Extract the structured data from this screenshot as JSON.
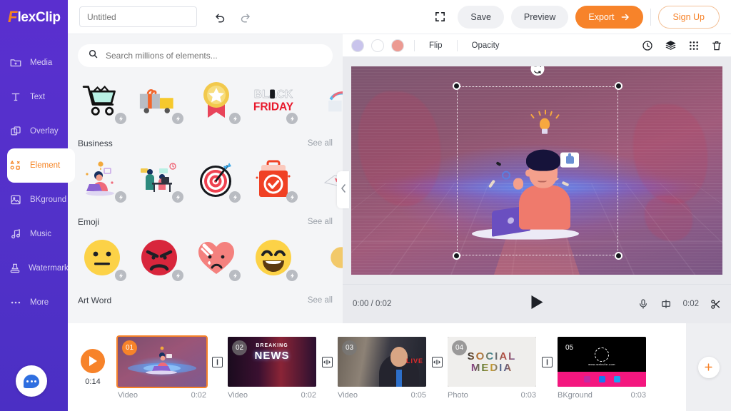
{
  "brand": {
    "accent_letter": "F",
    "rest": "lexClip",
    "accent_color": "#f58220"
  },
  "topbar": {
    "project_title_value": "",
    "project_title_placeholder": "Untitled",
    "undo_icon": "undo-icon",
    "redo_icon": "redo-icon",
    "fullscreen_icon": "fullscreen-icon",
    "save_label": "Save",
    "preview_label": "Preview",
    "export_label": "Export",
    "signup_label": "Sign Up",
    "export_color": "#f7832a"
  },
  "sidebar": {
    "items": [
      {
        "label": "Media",
        "icon": "media-folder-icon",
        "active": false
      },
      {
        "label": "Text",
        "icon": "text-t-icon",
        "active": false
      },
      {
        "label": "Overlay",
        "icon": "overlay-squares-icon",
        "active": false
      },
      {
        "label": "Element",
        "icon": "element-shapes-icon",
        "active": true
      },
      {
        "label": "BKground",
        "icon": "background-image-icon",
        "active": false
      },
      {
        "label": "Music",
        "icon": "music-note-icon",
        "active": false
      },
      {
        "label": "Watermark",
        "icon": "watermark-stamp-icon",
        "active": false
      },
      {
        "label": "More",
        "icon": "more-dots-icon",
        "active": false
      }
    ],
    "chat_icon": "chat-bubble-icon"
  },
  "panel": {
    "search": {
      "value": "",
      "placeholder": "Search millions of elements...",
      "icon": "search-icon"
    },
    "see_all_label": "See all",
    "rows": [
      {
        "category": "",
        "show_header": false,
        "items": [
          {
            "name": "shopping-cart-element"
          },
          {
            "name": "gift-truck-element"
          },
          {
            "name": "award-badge-element"
          },
          {
            "name": "black-friday-element"
          },
          {
            "name": "partial-element"
          }
        ]
      },
      {
        "category": "Business",
        "show_header": true,
        "items": [
          {
            "name": "person-laptop-element"
          },
          {
            "name": "office-meeting-element"
          },
          {
            "name": "target-dartboard-element"
          },
          {
            "name": "checklist-clipboard-element"
          },
          {
            "name": "partial-element"
          }
        ]
      },
      {
        "category": "Emoji",
        "show_header": true,
        "items": [
          {
            "name": "neutral-face-emoji"
          },
          {
            "name": "angry-face-emoji"
          },
          {
            "name": "broken-heart-emoji"
          },
          {
            "name": "grinning-face-emoji"
          },
          {
            "name": "partial-emoji"
          }
        ]
      },
      {
        "category": "Art Word",
        "show_header": true,
        "items": []
      }
    ],
    "collapse_icon": "chevron-left-icon"
  },
  "canvas": {
    "toolbar": {
      "swatches": [
        "#c9c4ec",
        "#ffffff",
        "#ec9a92"
      ],
      "flip_label": "Flip",
      "opacity_label": "Opacity",
      "right_icons": [
        "clock-icon",
        "layers-icon",
        "grid-icon",
        "trash-icon"
      ]
    },
    "selection": {
      "rotate_icon": "rotate-icon",
      "handles": [
        "top-left",
        "top-right",
        "bottom-left",
        "bottom-right"
      ]
    },
    "player": {
      "current_time": "0:00",
      "separator": "/",
      "duration": "0:02",
      "time_display": "0:00 / 0:02",
      "play_icon": "play-icon",
      "mic_icon": "microphone-icon",
      "split_icon": "split-icon",
      "clip_duration": "0:02",
      "scissors_icon": "scissors-icon"
    }
  },
  "timeline": {
    "play_icon": "play-icon",
    "total_duration": "0:14",
    "add_icon": "plus-icon",
    "clips": [
      {
        "index": "01",
        "type": "Video",
        "duration": "0:02",
        "selected": true,
        "thumb": "person-laptop-scene"
      },
      {
        "index": "02",
        "type": "Video",
        "duration": "0:02",
        "selected": false,
        "thumb": "breaking-news-scene",
        "line1": "BREAKING",
        "line2": "NEWS"
      },
      {
        "index": "03",
        "type": "Video",
        "duration": "0:05",
        "selected": false,
        "thumb": "reporter-live-scene",
        "badge": "LIVE"
      },
      {
        "index": "04",
        "type": "Photo",
        "duration": "0:03",
        "selected": false,
        "thumb": "social-media-scene",
        "line1": "SOCIAL",
        "line2": "MEDIA"
      },
      {
        "index": "05",
        "type": "BKground",
        "duration": "0:03",
        "selected": false,
        "thumb": "social-links-scene",
        "url": "www.website.com"
      }
    ],
    "transitions": [
      {
        "icon": "transition-cut-icon"
      },
      {
        "icon": "transition-dissolve-icon"
      },
      {
        "icon": "transition-dissolve-icon"
      },
      {
        "icon": "transition-cut-icon"
      }
    ]
  }
}
